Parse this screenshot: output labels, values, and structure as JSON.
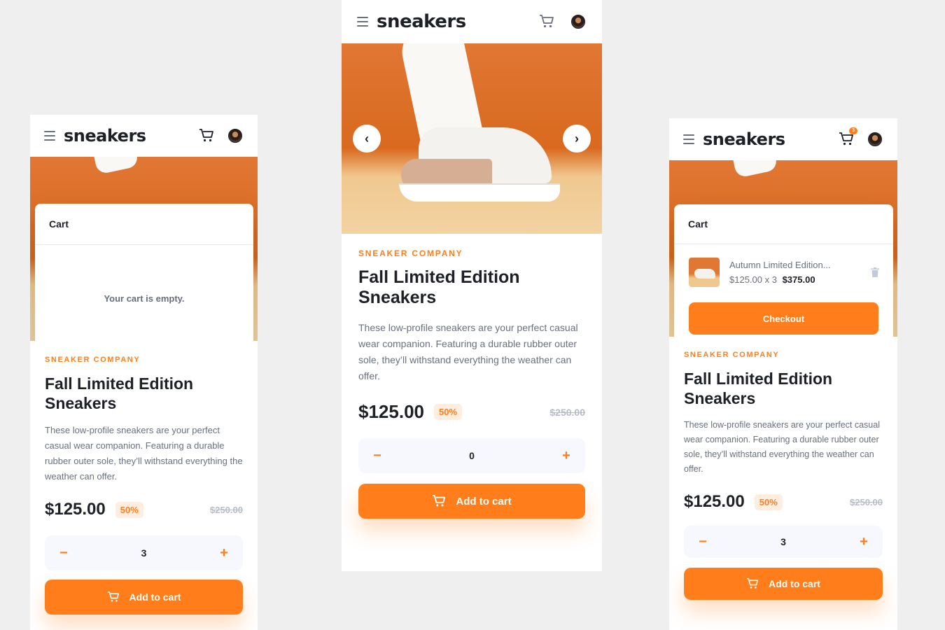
{
  "brand": {
    "logo": "sneakers",
    "accent": "#ff7e1b",
    "dark": "#1d2026",
    "muted": "#69707d"
  },
  "product": {
    "company": "SNEAKER COMPANY",
    "title": "Fall Limited Edition Sneakers",
    "description": "These low-profile sneakers are your perfect casual wear companion. Featuring a durable rubber outer sole, they’ll withstand everything the weather can offer.",
    "price": "$125.00",
    "discount": "50%",
    "old_price": "$250.00"
  },
  "controls": {
    "minus_icon": "minus-icon",
    "plus_icon": "plus-icon",
    "minus": "−",
    "plus": "+",
    "add_to_cart": "Add to cart",
    "prev": "‹",
    "next": "›"
  },
  "screens": {
    "left": {
      "quantity": "3",
      "cart": {
        "title": "Cart",
        "empty_text": "Your cart is empty."
      }
    },
    "center": {
      "quantity": "0"
    },
    "right": {
      "quantity": "3",
      "cart_badge": "3",
      "cart": {
        "title": "Cart",
        "item_name": "Autumn Limited Edition...",
        "item_unit": "$125.00 x 3",
        "item_total": "$375.00",
        "checkout": "Checkout"
      }
    }
  }
}
